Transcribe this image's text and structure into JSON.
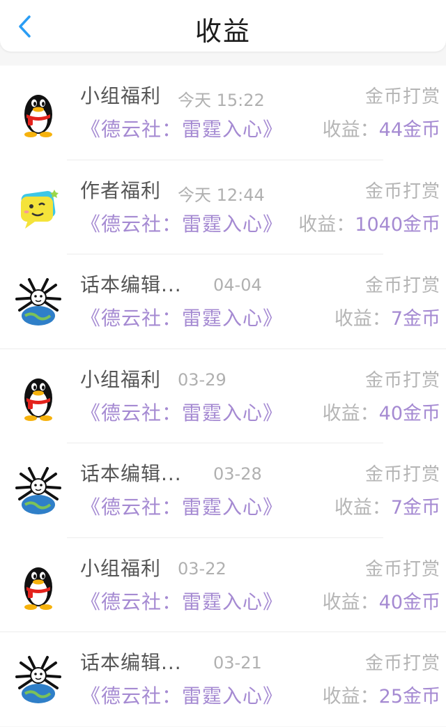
{
  "header": {
    "title": "收益",
    "back_icon": "chevron-left-icon",
    "accent": "#2a9df4"
  },
  "colors": {
    "purple": "#a58ad2",
    "gray_text": "#b5b5b5",
    "name_text": "#555555"
  },
  "records": [
    {
      "avatar": "penguin-avatar-icon",
      "name": "小组福利",
      "time": "今天 15:22",
      "tag": "金币打赏",
      "work": "《德云社：雷霆入心》",
      "income_label": "收益：",
      "amount": "44金币"
    },
    {
      "avatar": "chat-bubble-avatar-icon",
      "name": "作者福利",
      "time": "今天 12:44",
      "tag": "金币打赏",
      "work": "《德云社：雷霆入心》",
      "income_label": "收益：",
      "amount": "1040金币"
    },
    {
      "avatar": "globe-creature-avatar-icon",
      "name": "话本编辑...",
      "time": "04-04",
      "tag": "金币打赏",
      "work": "《德云社：雷霆入心》",
      "income_label": "收益：",
      "amount": "7金币"
    },
    {
      "avatar": "penguin-avatar-icon",
      "name": "小组福利",
      "time": "03-29",
      "tag": "金币打赏",
      "work": "《德云社：雷霆入心》",
      "income_label": "收益：",
      "amount": "40金币"
    },
    {
      "avatar": "globe-creature-avatar-icon",
      "name": "话本编辑...",
      "time": "03-28",
      "tag": "金币打赏",
      "work": "《德云社：雷霆入心》",
      "income_label": "收益：",
      "amount": "7金币"
    },
    {
      "avatar": "penguin-avatar-icon",
      "name": "小组福利",
      "time": "03-22",
      "tag": "金币打赏",
      "work": "《德云社：雷霆入心》",
      "income_label": "收益：",
      "amount": "40金币"
    },
    {
      "avatar": "globe-creature-avatar-icon",
      "name": "话本编辑...",
      "time": "03-21",
      "tag": "金币打赏",
      "work": "《德云社：雷霆入心》",
      "income_label": "收益：",
      "amount": "25金币"
    }
  ]
}
